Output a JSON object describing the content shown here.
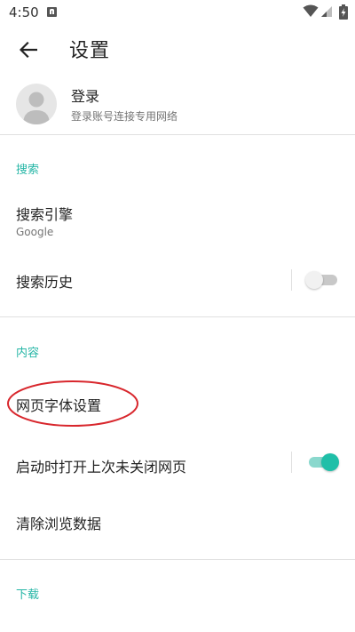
{
  "status_bar": {
    "time": "4:50"
  },
  "app_bar": {
    "title": "设置"
  },
  "account": {
    "title": "登录",
    "subtitle": "登录账号连接专用网络"
  },
  "sections": {
    "search": {
      "header": "搜索",
      "engine": {
        "title": "搜索引擎",
        "summary": "Google"
      },
      "history": {
        "title": "搜索历史",
        "enabled": false
      }
    },
    "content": {
      "header": "内容",
      "font": {
        "title": "网页字体设置"
      },
      "restore": {
        "title": "启动时打开上次未关闭网页",
        "enabled": true
      },
      "clear": {
        "title": "清除浏览数据"
      }
    },
    "download": {
      "header": "下载"
    }
  },
  "colors": {
    "accent": "#26b6a6",
    "switch_on": "#1fbfa8",
    "annotation": "#d8262c"
  }
}
